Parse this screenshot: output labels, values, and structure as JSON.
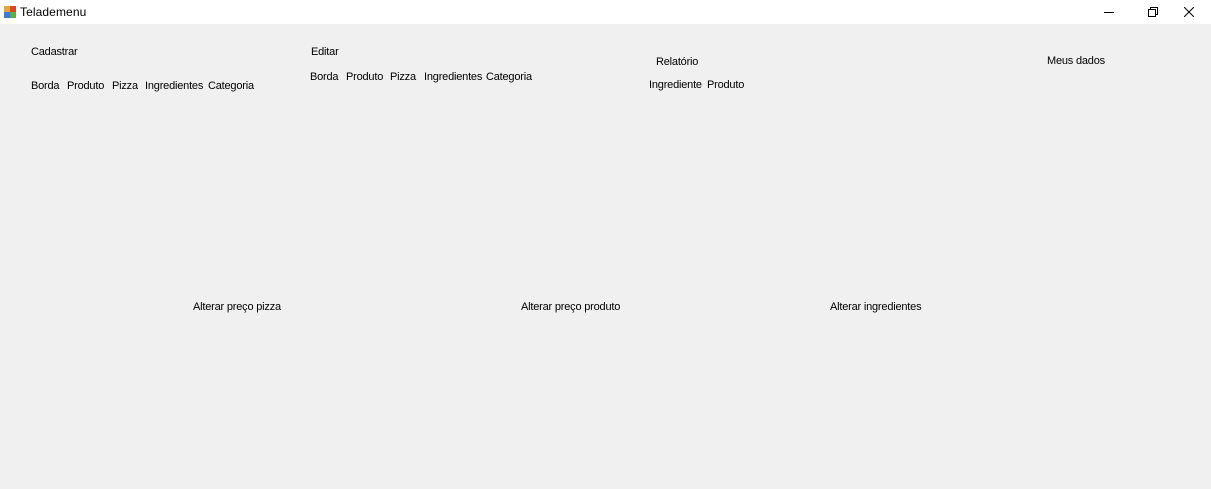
{
  "window": {
    "title": "Telademenu",
    "controls": {
      "minimize_icon": "minimize-icon",
      "maximize_icon": "restore-icon",
      "close_icon": "close-icon"
    }
  },
  "cadastrar": {
    "heading": "Cadastrar",
    "items": [
      "Borda",
      "Produto",
      "Pizza",
      "Ingredientes",
      "Categoria"
    ]
  },
  "editar": {
    "heading": "Editar",
    "items": [
      "Borda",
      "Produto",
      "Pizza",
      "Ingredientes",
      "Categoria"
    ]
  },
  "relatorio": {
    "heading": "Relatório",
    "items": [
      "Ingrediente",
      "Produto"
    ]
  },
  "meus_dados": "Meus dados",
  "actions": {
    "alterar_preco_pizza": "Alterar preço pizza",
    "alterar_preco_produto": "Alterar preço produto",
    "alterar_ingredientes": "Alterar ingredientes"
  },
  "colors": {
    "form_background": "#f0f0f0",
    "titlebar_background": "#ffffff",
    "text": "#000000"
  }
}
